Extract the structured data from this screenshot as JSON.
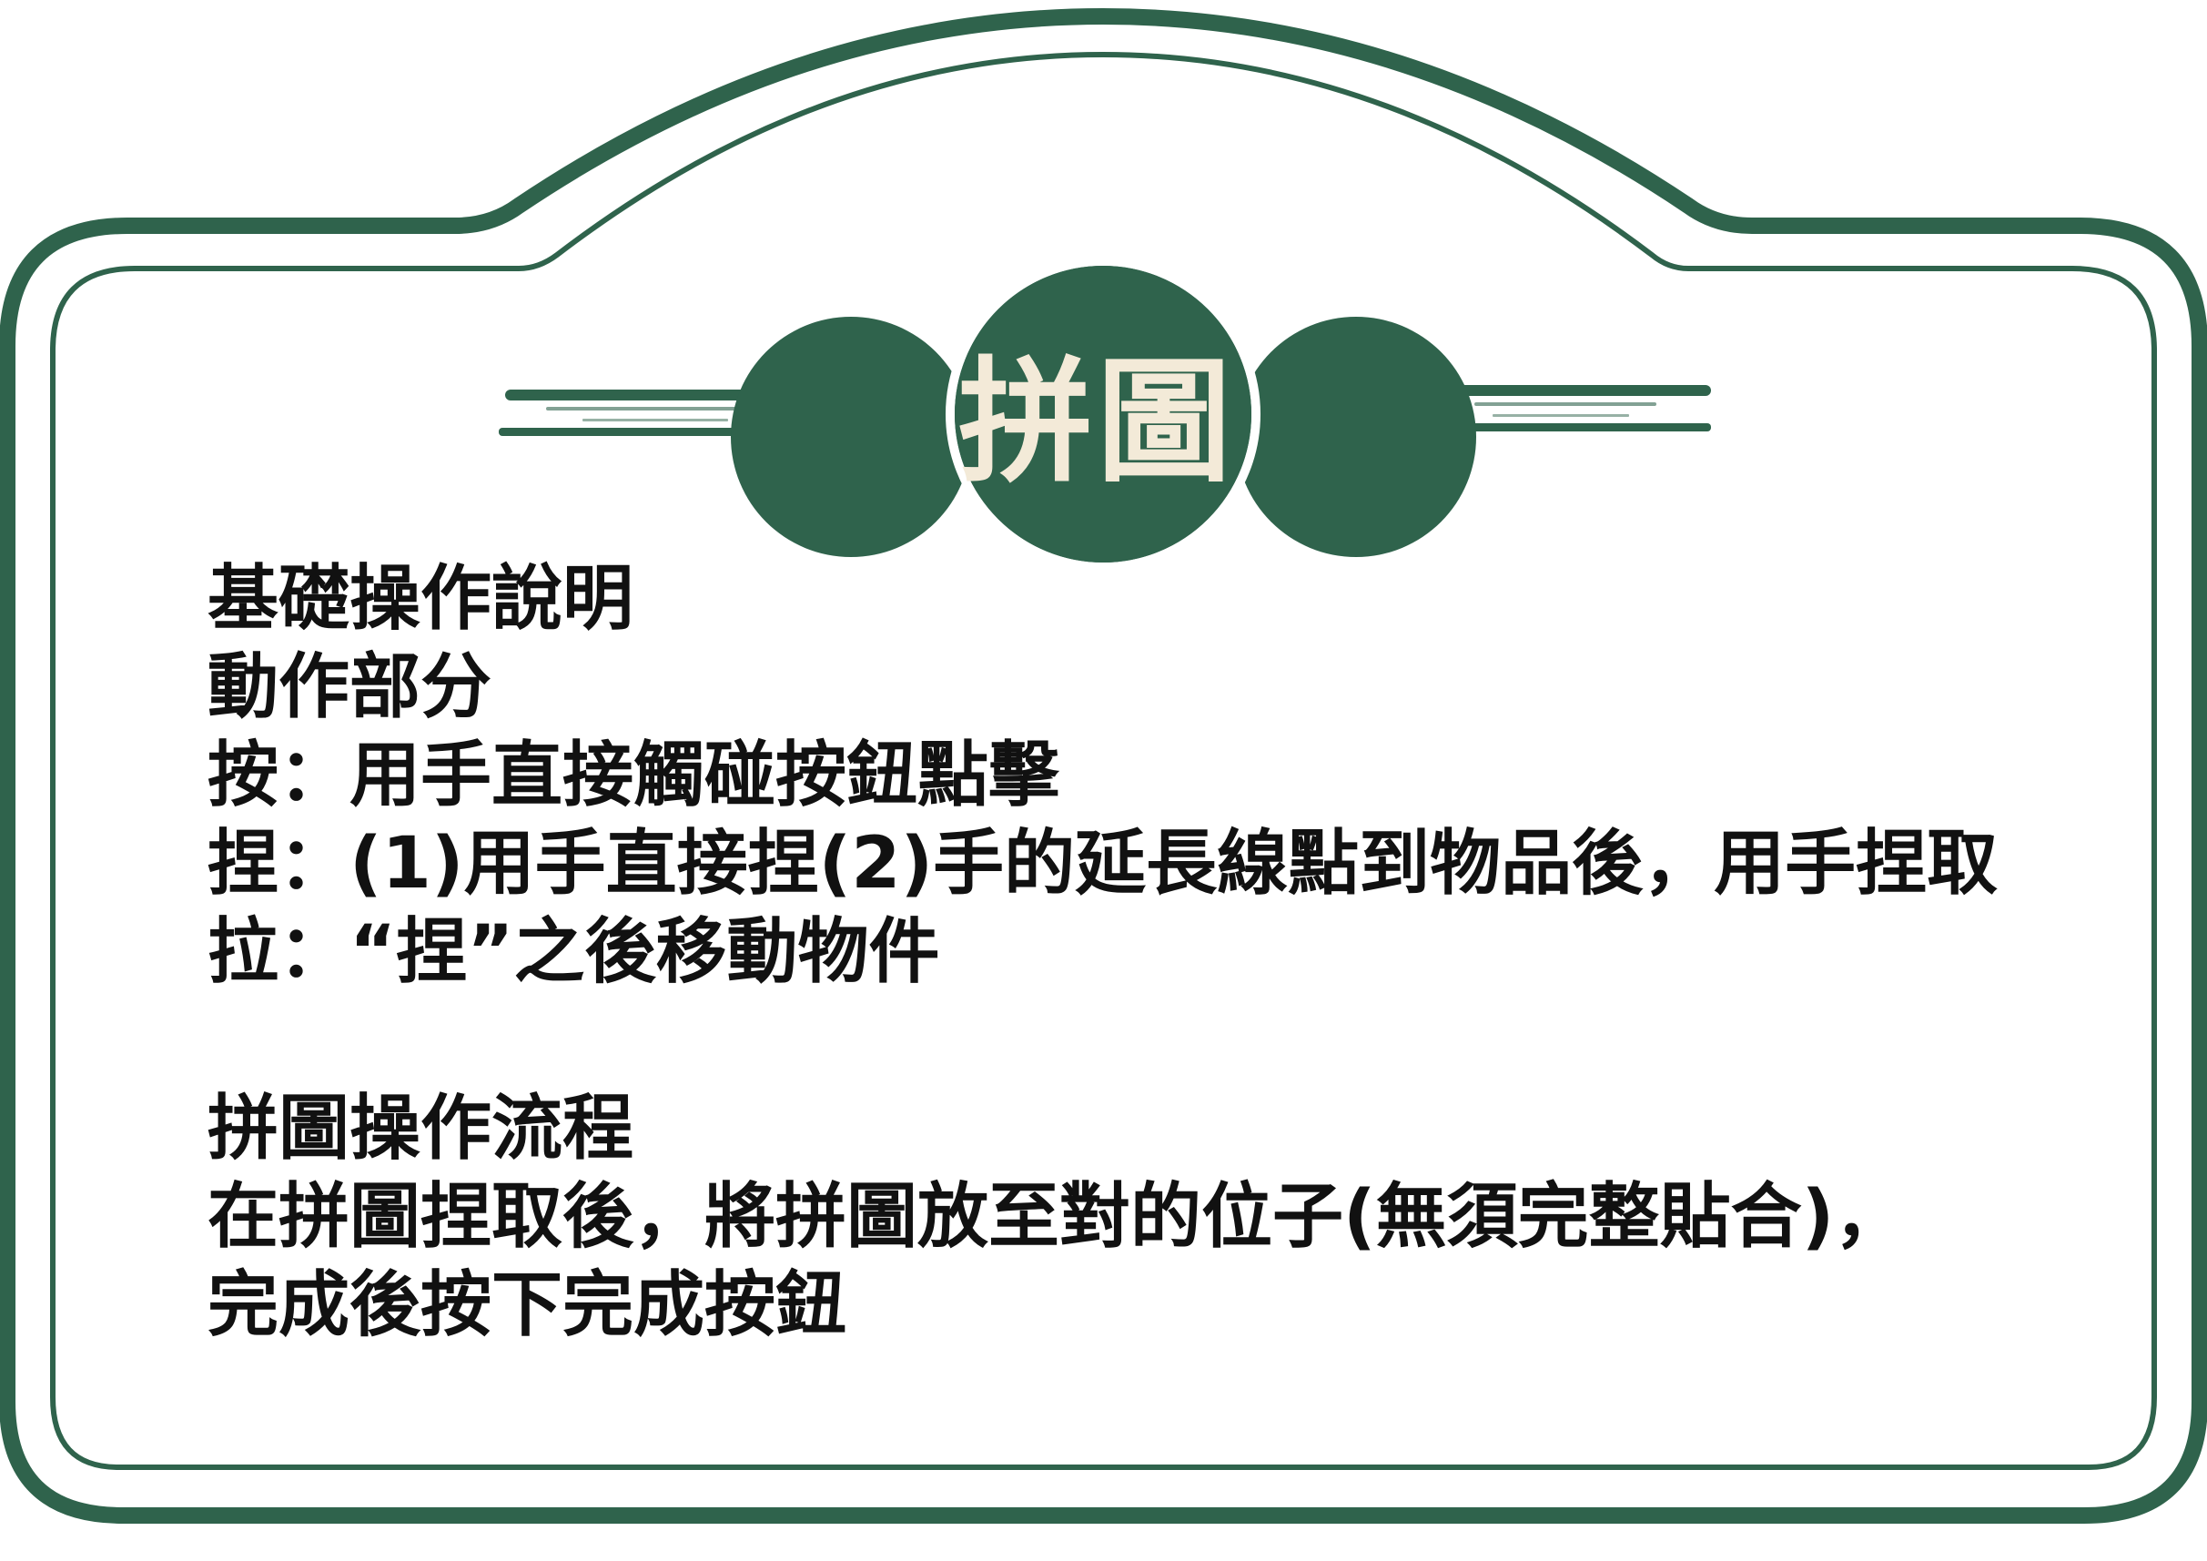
{
  "title": "拼圖",
  "colors": {
    "frame": "#2f634c",
    "title_text": "#f3ead8",
    "body_text": "#111111",
    "background": "#ffffff"
  },
  "basics": {
    "heading": "基礎操作說明",
    "subheading": "動作部分",
    "press": "按：用手直接觸碰按鈕點擊",
    "pinch": "捏：(1)用手直接捏(2)手的延長線點到物品後，用手捏取",
    "pull": "拉：“捏”之後移動物件"
  },
  "flow": {
    "heading": "拼圖操作流程",
    "step1": "在拼圖捏取後，將拼圖放至對的位子(無須完整貼合)，",
    "step2": "完成後按下完成按鈕"
  }
}
